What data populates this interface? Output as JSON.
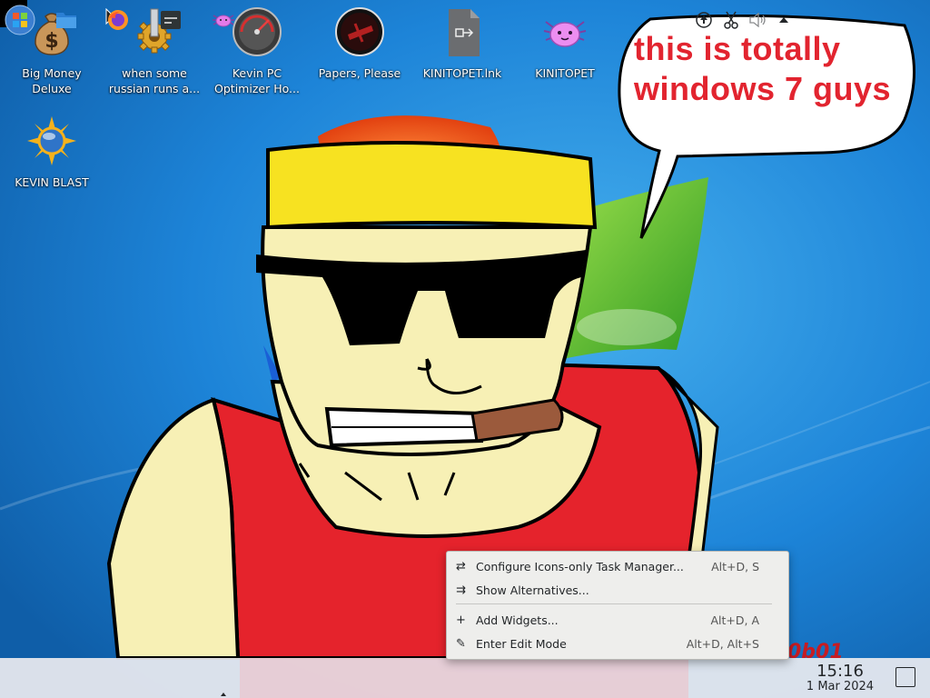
{
  "desktop": {
    "icons": [
      {
        "label": "Big Money Deluxe",
        "icon": "money-bag-icon"
      },
      {
        "label": "when some russian runs a...",
        "icon": "gear-icon"
      },
      {
        "label": "Kevin PC Optimizer Ho...",
        "icon": "speedometer-icon"
      },
      {
        "label": "Papers, Please",
        "icon": "papers-please-icon"
      },
      {
        "label": "KINITOPET.lnk",
        "icon": "shortcut-file-icon"
      },
      {
        "label": "KINITOPET",
        "icon": "axolotl-icon"
      },
      {
        "label": "KEVIN BLAST",
        "icon": "sun-orb-icon"
      }
    ]
  },
  "wallpaper": {
    "speech_bubble_text_line1": "this is totally",
    "speech_bubble_text_line2": "windows 7 guys",
    "signature": "0b01",
    "colors": {
      "sky": "#1f86d9",
      "cap": "#f7e221",
      "shirt": "#e5232c",
      "skin": "#f7f0b5",
      "text": "#e2242f"
    }
  },
  "context_menu": {
    "items": [
      {
        "label": "Configure Icons-only Task Manager...",
        "shortcut": "Alt+D, S",
        "icon": "configure-icon"
      },
      {
        "label": "Show Alternatives...",
        "shortcut": "",
        "icon": "alternatives-icon"
      },
      {
        "label": "Add Widgets...",
        "shortcut": "Alt+D, A",
        "icon": "plus-icon"
      },
      {
        "label": "Enter Edit Mode",
        "shortcut": "Alt+D, Alt+S",
        "icon": "pencil-icon"
      }
    ]
  },
  "taskbar": {
    "launcher": {
      "icon": "windows-start-icon"
    },
    "pinned": [
      {
        "name": "file-manager",
        "icon": "folder-icon"
      },
      {
        "name": "firefox",
        "icon": "firefox-icon"
      },
      {
        "name": "terminal",
        "icon": "terminal-icon"
      },
      {
        "name": "kinitopet",
        "icon": "axolotl-icon"
      }
    ],
    "tray": [
      "update-icon",
      "scissors-icon",
      "volume-icon",
      "expand-tray-icon"
    ],
    "clock": {
      "time": "15:16",
      "date": "1 Mar 2024"
    }
  }
}
